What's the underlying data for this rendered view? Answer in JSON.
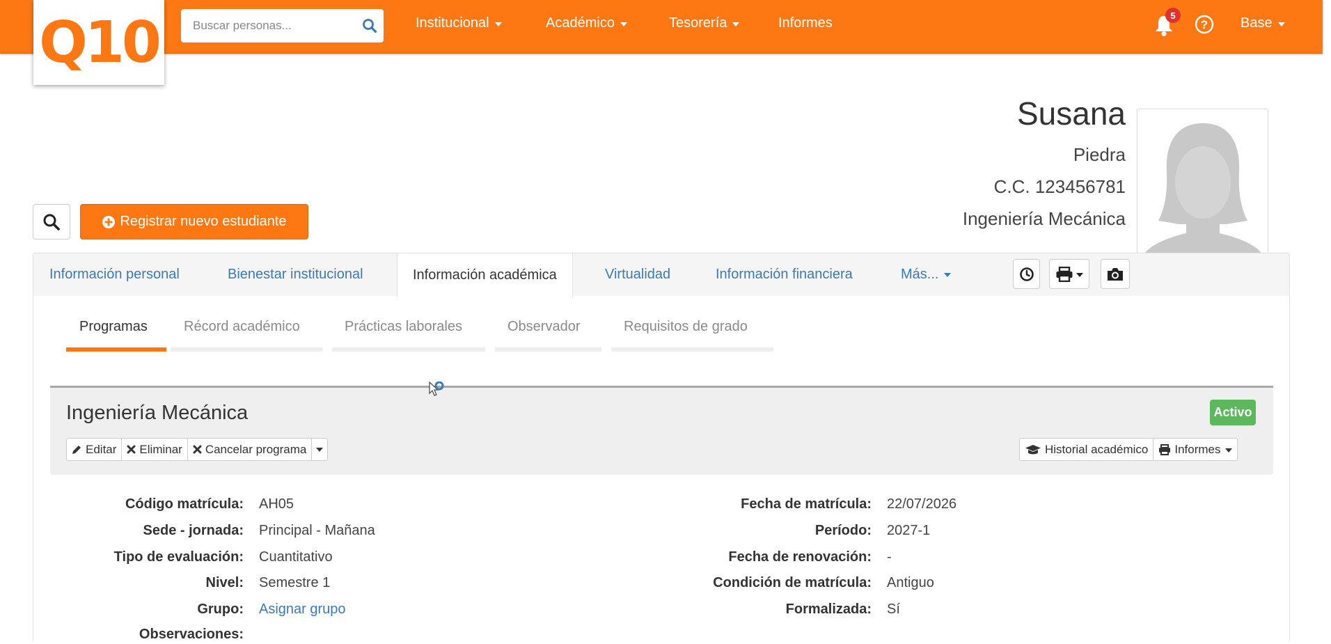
{
  "header": {
    "logo_text": "Q10",
    "search_placeholder": "Buscar personas...",
    "nav": [
      "Institucional",
      "Académico",
      "Tesorería",
      "Informes"
    ],
    "notification_count": "5",
    "user_menu": "Base",
    "colors": {
      "brand": "#fd7812",
      "link": "#3c7ab5",
      "success": "#5cb85c",
      "badge": "#e0312c"
    }
  },
  "profile": {
    "first_name": "Susana",
    "last_name": "Piedra",
    "document": "C.C. 123456781",
    "program": "Ingeniería Mecánica"
  },
  "actions": {
    "register_label": "Registrar nuevo estudiante"
  },
  "tabs": [
    "Información personal",
    "Bienestar institucional",
    "Información académica",
    "Virtualidad",
    "Información financiera",
    "Más..."
  ],
  "active_tab": "Información académica",
  "subtabs": [
    "Programas",
    "Récord académico",
    "Prácticas laborales",
    "Observador",
    "Requisitos de grado"
  ],
  "active_subtab": "Programas",
  "program_card": {
    "title": "Ingeniería Mecánica",
    "status": "Activo",
    "left_buttons": [
      "Editar",
      "Eliminar",
      "Cancelar programa"
    ],
    "right_buttons": [
      "Historial académico",
      "Informes"
    ]
  },
  "details_left": [
    {
      "label": "Código matrícula:",
      "value": "AH05"
    },
    {
      "label": "Sede - jornada:",
      "value": "Principal - Mañana"
    },
    {
      "label": "Tipo de evaluación:",
      "value": "Cuantitativo"
    },
    {
      "label": "Nivel:",
      "value": "Semestre 1"
    },
    {
      "label": "Grupo:",
      "value": "Asignar grupo"
    },
    {
      "label": "Observaciones:",
      "value": ""
    }
  ],
  "details_right": [
    {
      "label": "Fecha de matrícula:",
      "value": "22/07/2026"
    },
    {
      "label": "Período:",
      "value": "2027-1"
    },
    {
      "label": "Fecha de renovación:",
      "value": "-"
    },
    {
      "label": "Condición de matrícula:",
      "value": "Antiguo"
    },
    {
      "label": "Formalizada:",
      "value": "Sí"
    }
  ]
}
